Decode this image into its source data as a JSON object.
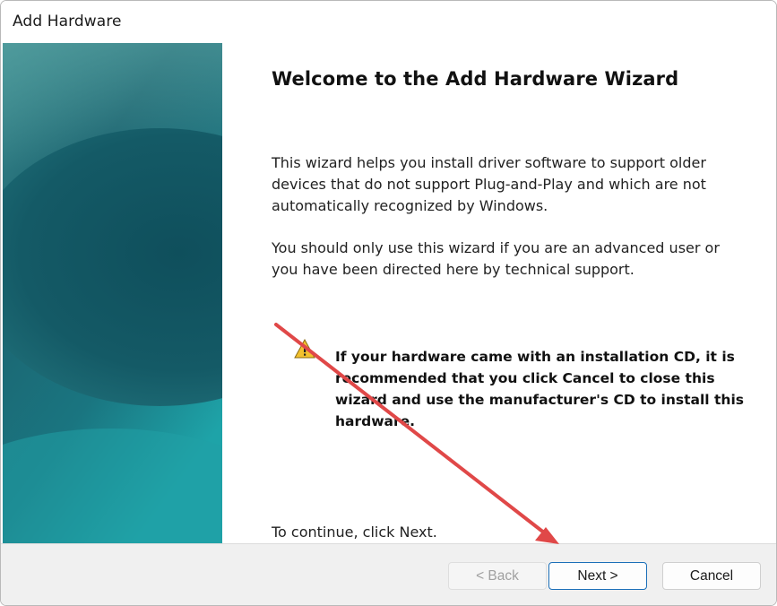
{
  "window": {
    "title": "Add Hardware"
  },
  "wizard": {
    "heading": "Welcome to the Add Hardware Wizard",
    "paragraph1": "This wizard helps you install driver software to support older devices that do not support Plug-and-Play and which are not automatically recognized by Windows.",
    "paragraph2": "You should only use this wizard if you are an advanced user or you have been directed here by technical support.",
    "warning_icon": "warning-triangle-icon",
    "warning_text": "If your hardware came with an installation CD, it is recommended that you click Cancel to close this wizard and use the manufacturer's CD to install this hardware.",
    "continue_text": "To continue, click Next."
  },
  "buttons": {
    "back_label": "< Back",
    "next_label": "Next >",
    "cancel_label": "Cancel"
  },
  "annotation": {
    "arrow_color": "#e04848"
  },
  "colors": {
    "banner_teal": "#1f6d78",
    "next_button_border": "#1b6fb8",
    "footer_background": "#f0f0f0"
  }
}
